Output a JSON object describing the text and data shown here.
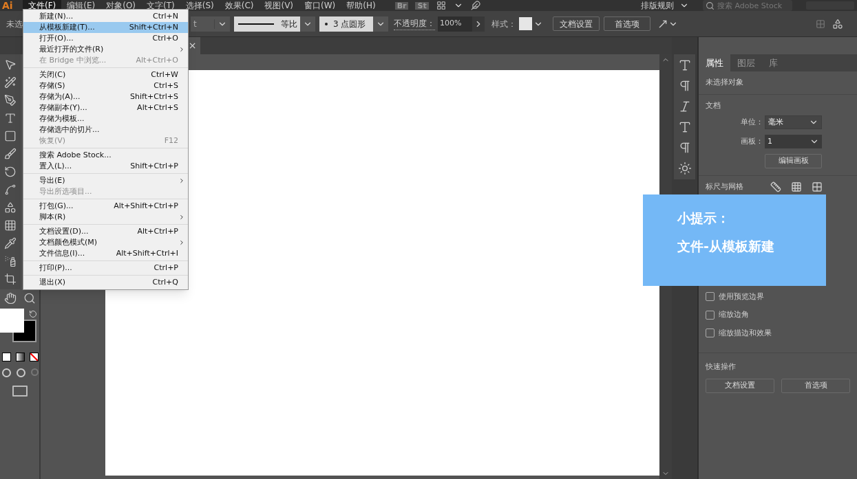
{
  "menu_bar": {
    "logo": "Ai",
    "items": [
      {
        "label": "文件(F)",
        "selected": true
      },
      {
        "label": "编辑(E)",
        "selected": false
      },
      {
        "label": "对象(O)",
        "selected": false
      },
      {
        "label": "文字(T)",
        "selected": false
      },
      {
        "label": "选择(S)",
        "selected": false
      },
      {
        "label": "效果(C)",
        "selected": false
      },
      {
        "label": "视图(V)",
        "selected": false
      },
      {
        "label": "窗口(W)",
        "selected": false
      },
      {
        "label": "帮助(H)",
        "selected": false
      }
    ],
    "badges": [
      "Br",
      "St"
    ],
    "workspace": "排版规则",
    "search": {
      "placeholder": "搜索 Adobe Stock"
    }
  },
  "control_bar": {
    "selection_text": "未选",
    "font_value": "t",
    "stroke_profile": "等比",
    "brush": "3 点圆形",
    "opacity_label": "不透明度：",
    "opacity_value": "100%",
    "style_label": "样式：",
    "buttons": [
      "文档设置",
      "首选项"
    ]
  },
  "document_tab": {
    "close": "×"
  },
  "file_menu": {
    "groups": [
      [
        {
          "label": "新建(N)...",
          "shortcut": "Ctrl+N",
          "disabled": false,
          "submenu": false,
          "selected": false
        },
        {
          "label": "从模板新建(T)...",
          "shortcut": "Shift+Ctrl+N",
          "disabled": false,
          "submenu": false,
          "selected": true
        },
        {
          "label": "打开(O)...",
          "shortcut": "Ctrl+O",
          "disabled": false,
          "submenu": false,
          "selected": false
        },
        {
          "label": "最近打开的文件(R)",
          "disabled": false,
          "submenu": true,
          "selected": false
        },
        {
          "label": "在 Bridge 中浏览...",
          "shortcut": "Alt+Ctrl+O",
          "disabled": true,
          "submenu": false,
          "selected": false
        }
      ],
      [
        {
          "label": "关闭(C)",
          "shortcut": "Ctrl+W",
          "disabled": false,
          "submenu": false,
          "selected": false
        },
        {
          "label": "存储(S)",
          "shortcut": "Ctrl+S",
          "disabled": false,
          "submenu": false,
          "selected": false
        },
        {
          "label": "存储为(A)...",
          "shortcut": "Shift+Ctrl+S",
          "disabled": false,
          "submenu": false,
          "selected": false
        },
        {
          "label": "存储副本(Y)...",
          "shortcut": "Alt+Ctrl+S",
          "disabled": false,
          "submenu": false,
          "selected": false
        },
        {
          "label": "存储为模板...",
          "disabled": false,
          "submenu": false,
          "selected": false
        },
        {
          "label": "存储选中的切片...",
          "disabled": false,
          "submenu": false,
          "selected": false
        },
        {
          "label": "恢复(V)",
          "shortcut": "F12",
          "disabled": true,
          "submenu": false,
          "selected": false
        }
      ],
      [
        {
          "label": "搜索 Adobe Stock...",
          "disabled": false,
          "submenu": false,
          "selected": false
        },
        {
          "label": "置入(L)...",
          "shortcut": "Shift+Ctrl+P",
          "disabled": false,
          "submenu": false,
          "selected": false
        }
      ],
      [
        {
          "label": "导出(E)",
          "disabled": false,
          "submenu": true,
          "selected": false
        },
        {
          "label": "导出所选项目...",
          "disabled": true,
          "submenu": false,
          "selected": false
        }
      ],
      [
        {
          "label": "打包(G)...",
          "shortcut": "Alt+Shift+Ctrl+P",
          "disabled": false,
          "submenu": false,
          "selected": false
        },
        {
          "label": "脚本(R)",
          "disabled": false,
          "submenu": true,
          "selected": false
        }
      ],
      [
        {
          "label": "文档设置(D)...",
          "shortcut": "Alt+Ctrl+P",
          "disabled": false,
          "submenu": false,
          "selected": false
        },
        {
          "label": "文档颜色模式(M)",
          "disabled": false,
          "submenu": true,
          "selected": false
        },
        {
          "label": "文件信息(I)...",
          "shortcut": "Alt+Shift+Ctrl+I",
          "disabled": false,
          "submenu": false,
          "selected": false
        }
      ],
      [
        {
          "label": "打印(P)...",
          "shortcut": "Ctrl+P",
          "disabled": false,
          "submenu": false,
          "selected": false
        }
      ],
      [
        {
          "label": "退出(X)",
          "shortcut": "Ctrl+Q",
          "disabled": false,
          "submenu": false,
          "selected": false
        }
      ]
    ]
  },
  "properties_panel": {
    "tabs": [
      {
        "label": "属性",
        "selected": true
      },
      {
        "label": "图层",
        "selected": false
      },
      {
        "label": "库",
        "selected": false
      }
    ],
    "status": "未选择对象",
    "document_title": "文档",
    "unit_label": "单位：",
    "unit": "毫米",
    "artboard_label": "画板：",
    "artboard": "1",
    "edit_artboards": "编辑画板",
    "rulers_title": "标尺与网格",
    "checkboxes": [
      {
        "label": "使用预览边界",
        "checked": false
      },
      {
        "label": "缩放边角",
        "checked": false
      },
      {
        "label": "缩放描边和效果",
        "checked": false
      }
    ],
    "quick_actions_title": "快速操作",
    "quick_actions": [
      "文档设置",
      "首选项"
    ]
  },
  "tip": {
    "title": "小提示：",
    "text": "文件-从模板新建"
  }
}
